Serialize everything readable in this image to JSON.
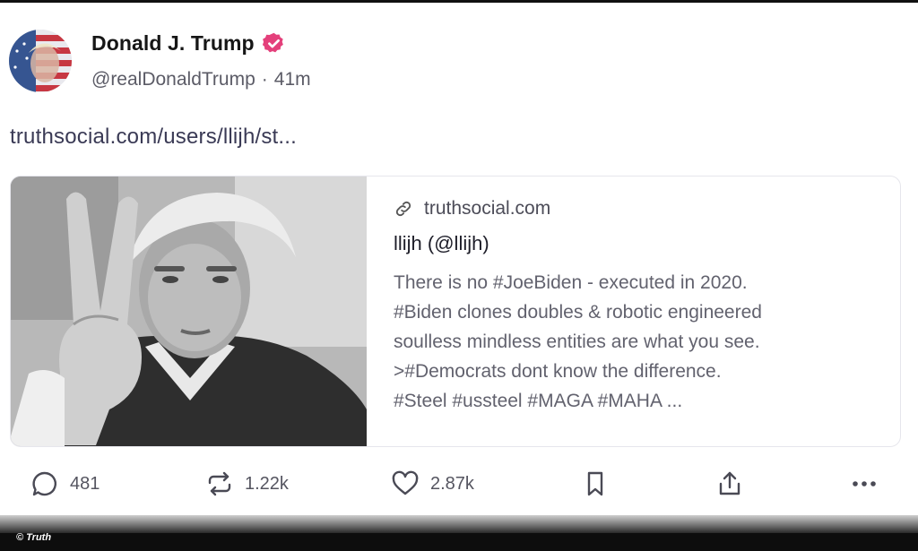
{
  "post": {
    "author": {
      "name": "Donald J. Trump",
      "handle": "@realDonaldTrump",
      "separator": "·",
      "time": "41m"
    },
    "link_text": "truthsocial.com/users/llijh/st...",
    "card": {
      "domain": "truthsocial.com",
      "title": "llijh (@llijh)",
      "description": "There is no #JoeBiden - executed in 2020.\n#Biden clones doubles & robotic engineered\nsoulless mindless entities are what you see.\n>#Democrats dont know the difference.\n#Steel #ussteel #MAGA #MAHA ..."
    },
    "actions": {
      "replies": "481",
      "reposts": "1.22k",
      "likes": "2.87k"
    }
  },
  "footer": {
    "credit": "© Truth"
  },
  "colors": {
    "verified": "#e4407b",
    "text": "#1a1a1a",
    "muted": "#5b5b66"
  },
  "icons": [
    "verified-badge-icon",
    "link-icon",
    "reply-icon",
    "repost-icon",
    "like-icon",
    "bookmark-icon",
    "share-icon",
    "more-icon"
  ]
}
